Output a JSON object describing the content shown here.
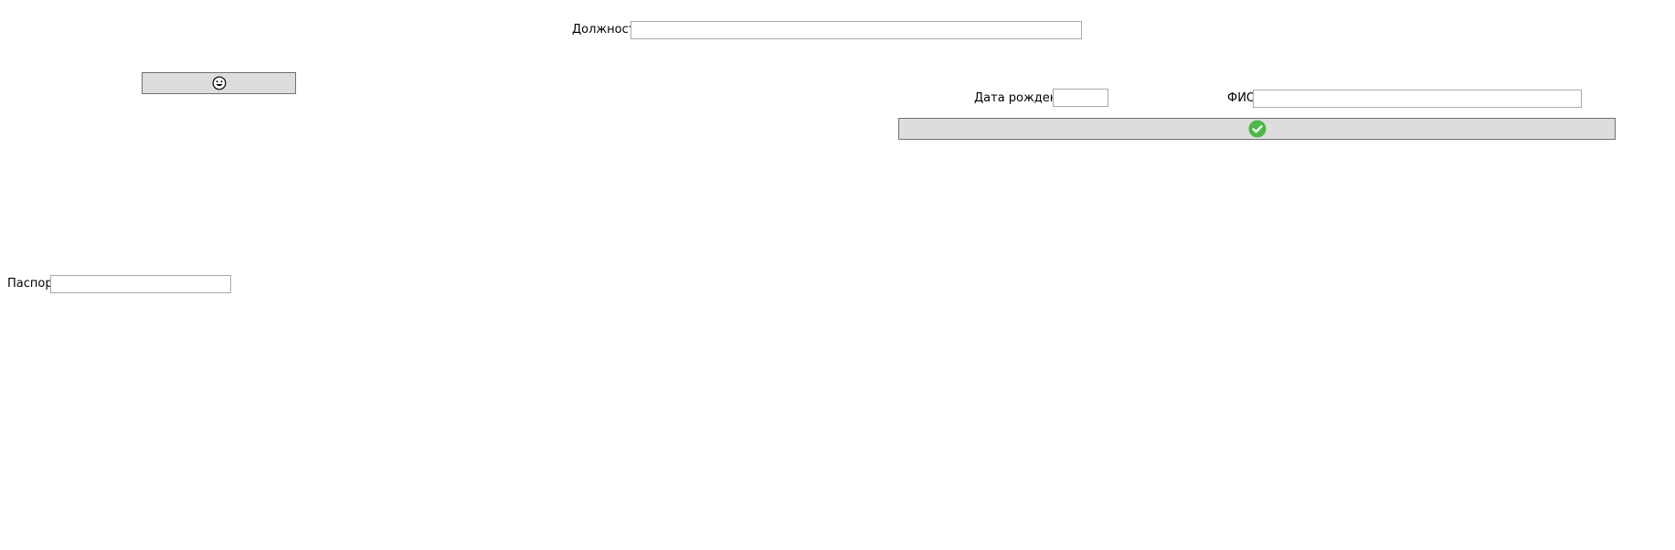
{
  "form": {
    "position_label": "Должность",
    "position_value": "",
    "birth_date_label": "Дата рождения",
    "birth_date_value": "",
    "full_name_label": "ФИО",
    "full_name_value": "",
    "passport_label": "Паспорт",
    "passport_value": ""
  },
  "buttons": {
    "secondary": {
      "icon": "smiley-face-icon"
    },
    "confirm": {
      "icon": "green-check-icon",
      "accent": "#4cb848"
    }
  }
}
